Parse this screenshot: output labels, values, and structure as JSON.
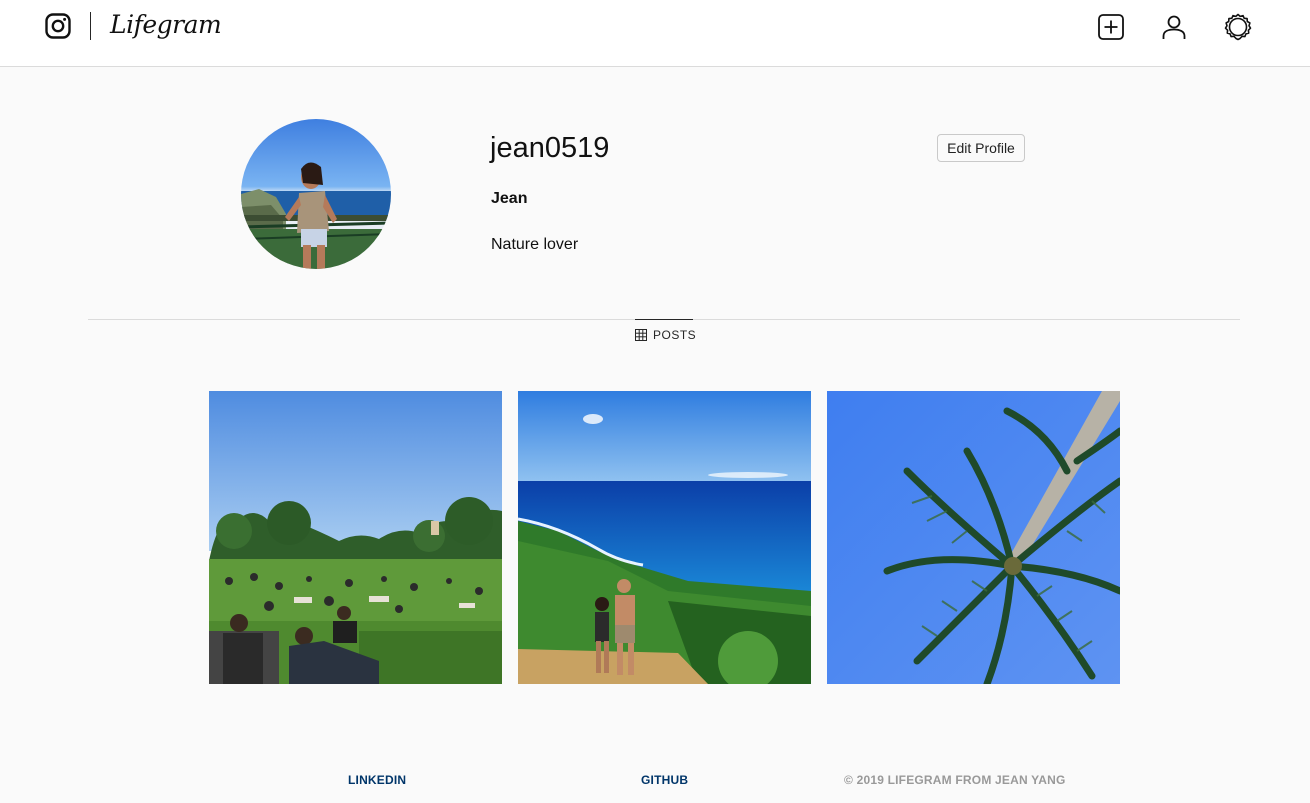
{
  "header": {
    "brand": "Lifegram",
    "logo_icon": "instagram-camera-icon",
    "actions": [
      {
        "name": "new-post",
        "icon": "plus-square-icon"
      },
      {
        "name": "profile",
        "icon": "user-icon"
      },
      {
        "name": "settings",
        "icon": "gear-icon"
      }
    ]
  },
  "profile": {
    "username": "jean0519",
    "edit_label": "Edit Profile",
    "full_name": "Jean",
    "bio": "Nature lover",
    "avatar": "avatar-photo"
  },
  "tabs": [
    {
      "label": "POSTS",
      "icon": "grid-icon",
      "active": true
    }
  ],
  "posts": [
    {
      "image": "park-lawn-photo"
    },
    {
      "image": "coastal-hike-photo"
    },
    {
      "image": "palm-tree-photo"
    }
  ],
  "footer": {
    "linkedin": "LINKEDIN",
    "github": "GITHUB",
    "copyright": "© 2019 LIFEGRAM FROM JEAN YANG"
  },
  "colors": {
    "background": "#fafafa",
    "footer_link": "#003569",
    "footer_text": "#999999",
    "border": "#dbdbdb"
  }
}
